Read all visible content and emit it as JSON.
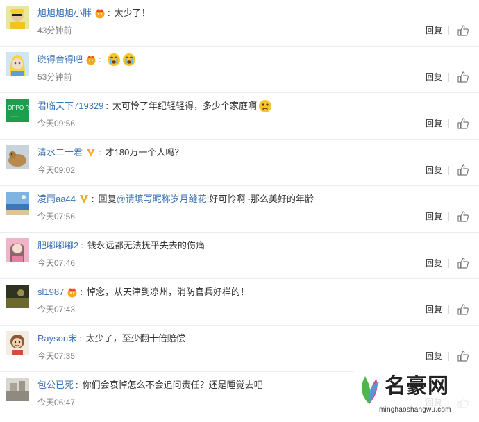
{
  "ui": {
    "reply_label": "回复",
    "link_color": "#3a73b6",
    "time_color": "#808080",
    "separator_color": "#ececec"
  },
  "comments": [
    {
      "user": "旭旭旭旭小胖",
      "badge": "vip-crown-red",
      "text": "太少了！",
      "time": "43分钟前"
    },
    {
      "user": "晓得舍得吧",
      "badge": "vip-crown-red",
      "text": "",
      "emoji": [
        "crying-face-icon",
        "crying-face-icon"
      ],
      "time": "53分钟前"
    },
    {
      "user": "君临天下719329",
      "badge": "",
      "text": "太可怜了年纪轻轻得，多少个家庭啊",
      "emoji": [
        "sad-face-icon"
      ],
      "time": "今天09:56"
    },
    {
      "user": "清水二十君",
      "badge": "verified-v-yellow",
      "text": "才180万一个人吗？",
      "time": "今天09:02"
    },
    {
      "user": "凌雨aa44",
      "badge": "verified-v-yellow",
      "text_prefix": "回复",
      "mention": "@请填写昵称岁月缝花",
      "text": ":好可怜啊~那么美好的年龄",
      "time": "今天07:56"
    },
    {
      "user": "肥嘟嘟嘟2",
      "badge": "",
      "text": "钱永远都无法抚平失去的伤痛",
      "time": "今天07:46"
    },
    {
      "user": "sl1987",
      "badge": "vip-crown-red",
      "text": "悼念，从天津到凉州，消防官兵好样的！",
      "time": "今天07:43"
    },
    {
      "user": "Rayson宋",
      "badge": "",
      "text": "太少了，至少翻十倍赔偿",
      "time": "今天07:35"
    },
    {
      "user": "包公已死",
      "badge": "",
      "text": "你们会哀悼怎么不会追问责任？还是睡觉去吧",
      "time": "今天06:47"
    }
  ],
  "watermark": {
    "title": "名豪网",
    "url": "minghaoshangwu.com"
  }
}
